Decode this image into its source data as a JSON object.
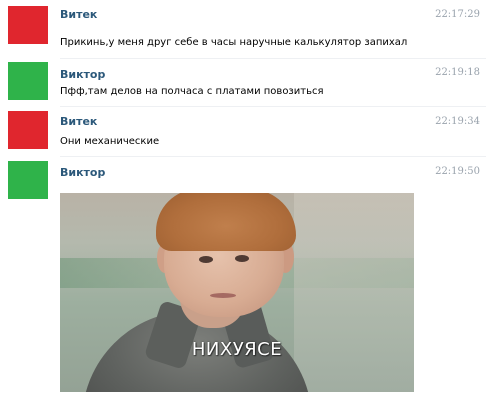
{
  "colors": {
    "avatar_vitek": "#e0262e",
    "avatar_viktor": "#2fb34a",
    "author_link": "#2b587a",
    "timestamp": "#9aa3ad",
    "background": "#ffffff"
  },
  "messages": [
    {
      "author": "Витек",
      "time": "22:17:29",
      "text": "Прикинь,у меня друг себе в часы наручные калькулятор запихал",
      "avatar_color": "#e0262e"
    },
    {
      "author": "Виктор",
      "time": "22:19:18",
      "text": "Пфф,там делов на полчаса с платами повозиться",
      "avatar_color": "#2fb34a"
    },
    {
      "author": "Витек",
      "time": "22:19:34",
      "text": "Они механические",
      "avatar_color": "#e0262e"
    },
    {
      "author": "Виктор",
      "time": "22:19:50",
      "avatar_color": "#2fb34a",
      "attachment": {
        "type": "photo",
        "caption": "НИХУЯСЕ"
      }
    }
  ]
}
